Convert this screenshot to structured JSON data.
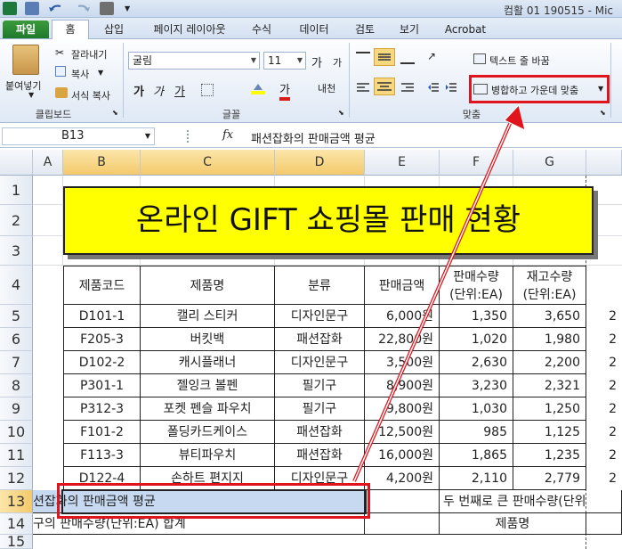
{
  "window": {
    "title": "컴활 01 190515 - Mic"
  },
  "tabs": [
    {
      "label": "파일"
    },
    {
      "label": "홈"
    },
    {
      "label": "삽입"
    },
    {
      "label": "페이지 레이아웃"
    },
    {
      "label": "수식"
    },
    {
      "label": "데이터"
    },
    {
      "label": "검토"
    },
    {
      "label": "보기"
    },
    {
      "label": "Acrobat"
    }
  ],
  "ribbon": {
    "clipboard": {
      "paste": "붙여넣기",
      "cut": "잘라내기",
      "copy": "복사",
      "format_painter": "서식 복사",
      "label": "클립보드"
    },
    "font": {
      "name": "굴림",
      "size": "11",
      "grow": "가",
      "shrink": "가",
      "bold": "가",
      "italic": "가",
      "underline": "가",
      "color_letter": "가",
      "phonetic": "내천",
      "label": "글꼴"
    },
    "alignment": {
      "wrap_text": "텍스트 줄 바꿈",
      "merge_center": "병합하고 가운데 맞춤",
      "label": "맞춤"
    }
  },
  "formula_bar": {
    "cell_ref": "B13",
    "fx": "fx",
    "content": "패션잡화의 판매금액 평균"
  },
  "columns": [
    "A",
    "B",
    "C",
    "D",
    "E",
    "F",
    "G"
  ],
  "rows": [
    "1",
    "2",
    "3",
    "4",
    "5",
    "6",
    "7",
    "8",
    "9",
    "10",
    "11",
    "12",
    "13",
    "14",
    "15"
  ],
  "banner": {
    "title": "온라인 GIFT 쇼핑몰 판매 현황"
  },
  "table": {
    "headers": {
      "code": "제품코드",
      "name": "제품명",
      "category": "분류",
      "price": "판매금액",
      "sales_qty_1": "판매수량",
      "sales_qty_2": "(단위:EA)",
      "stock_qty_1": "재고수량",
      "stock_qty_2": "(단위:EA)"
    },
    "rows": [
      {
        "code": "D101-1",
        "name": "캘리 스티커",
        "category": "디자인문구",
        "price": "6,000원",
        "sales": "1,350",
        "stock": "3,650",
        "h": "2"
      },
      {
        "code": "F205-3",
        "name": "버킷백",
        "category": "패션잡화",
        "price": "22,800원",
        "sales": "1,020",
        "stock": "1,980",
        "h": "2"
      },
      {
        "code": "D102-2",
        "name": "캐시플래너",
        "category": "디자인문구",
        "price": "3,500원",
        "sales": "2,630",
        "stock": "2,200",
        "h": "2"
      },
      {
        "code": "P301-1",
        "name": "젤잉크 볼펜",
        "category": "필기구",
        "price": "8,900원",
        "sales": "3,230",
        "stock": "2,321",
        "h": "2"
      },
      {
        "code": "P312-3",
        "name": "포켓 펜슬 파우치",
        "category": "필기구",
        "price": "9,800원",
        "sales": "1,030",
        "stock": "1,250",
        "h": "2"
      },
      {
        "code": "F101-2",
        "name": "폴딩카드케이스",
        "category": "패션잡화",
        "price": "12,500원",
        "sales": "985",
        "stock": "1,125",
        "h": "2"
      },
      {
        "code": "F113-3",
        "name": "뷰티파우치",
        "category": "패션잡화",
        "price": "16,000원",
        "sales": "1,865",
        "stock": "1,235",
        "h": "2"
      },
      {
        "code": "D122-4",
        "name": "손하트 편지지",
        "category": "디자인문구",
        "price": "4,200원",
        "sales": "2,110",
        "stock": "2,779",
        "h": "2"
      }
    ],
    "row13_left": "션잡화의 판매금액 평균",
    "row13_right": "두 번째로 큰 판매수량(단위",
    "row14_left": "구의 판매수량(단위:EA) 합계",
    "row14_right": "제품명"
  },
  "colors": {
    "highlight_red": "#e0141c",
    "banner_yellow": "#ffff00",
    "selected_cell": "#c6d9f1"
  }
}
